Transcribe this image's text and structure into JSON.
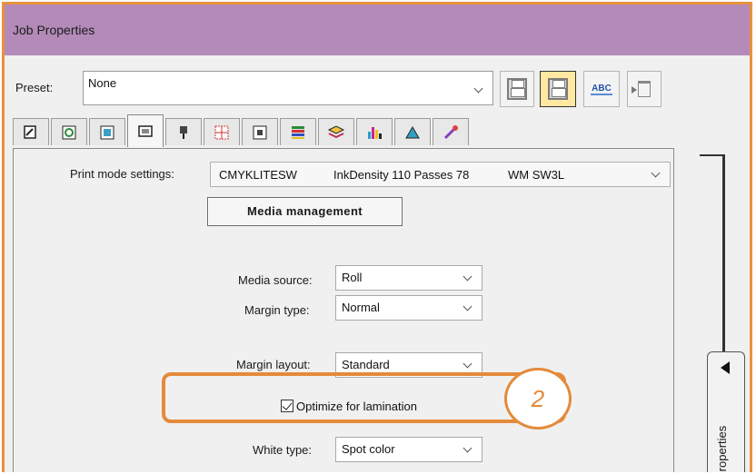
{
  "window": {
    "title": "Job Properties"
  },
  "preset": {
    "label": "Preset:",
    "value": "None"
  },
  "toolbar": {
    "buttons": [
      {
        "name": "save-preset",
        "icon": "floppy-disk-icon"
      },
      {
        "name": "save-as-preset",
        "icon": "floppy-disk-highlighted-icon"
      },
      {
        "name": "rename-preset",
        "icon": "abc-rename-icon",
        "text": "ABC"
      },
      {
        "name": "delete-preset",
        "icon": "trash-icon"
      }
    ]
  },
  "tabs": [
    {
      "icon": "page-layout-icon"
    },
    {
      "icon": "color-rotate-icon"
    },
    {
      "icon": "image-adjust-icon"
    },
    {
      "icon": "printer-media-icon",
      "active": true
    },
    {
      "icon": "cutter-icon"
    },
    {
      "icon": "grid-marks-icon"
    },
    {
      "icon": "layout-frame-icon"
    },
    {
      "icon": "color-bars-icon"
    },
    {
      "icon": "layers-icon"
    },
    {
      "icon": "ink-bars-icon"
    },
    {
      "icon": "color-shape-icon"
    },
    {
      "icon": "color-picker-icon"
    }
  ],
  "print_mode": {
    "label": "Print mode settings:",
    "mode": "CMYKLITESW",
    "density": "InkDensity 110 Passes 78",
    "wm": "WM SW3L"
  },
  "media_management": {
    "label": "Media management"
  },
  "media_source": {
    "label": "Media source:",
    "value": "Roll"
  },
  "margin_type": {
    "label": "Margin type:",
    "value": "Normal"
  },
  "margin_layout": {
    "label": "Margin layout:",
    "value": "Standard"
  },
  "lamination": {
    "label": "Optimize for lamination",
    "checked": true
  },
  "white_type": {
    "label": "White type:",
    "value": "Spot color"
  },
  "callout": {
    "number": "2"
  },
  "side_panel": {
    "label": "Properties"
  },
  "colors": {
    "title_bar": "#b38ab8",
    "highlight": "#e48a3a"
  }
}
